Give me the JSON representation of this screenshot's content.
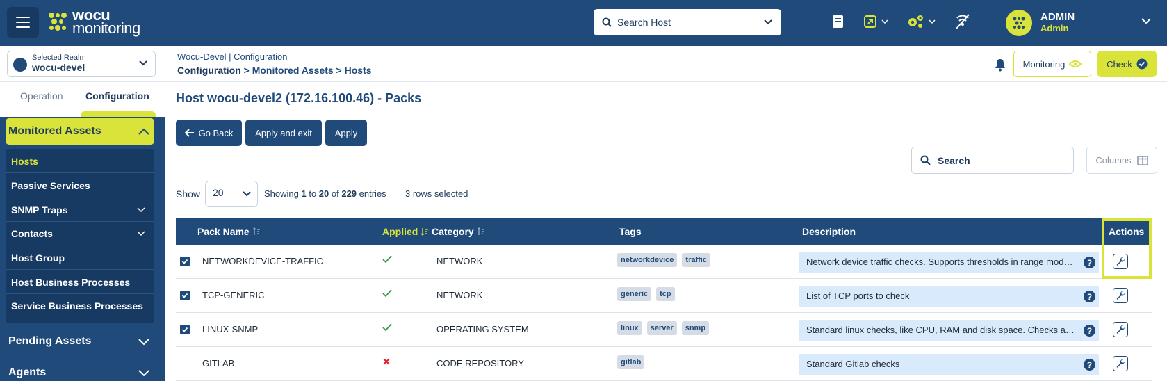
{
  "brand": {
    "line1": "wocu",
    "line2": "monitoring"
  },
  "header": {
    "search_host": "Search Host",
    "user": {
      "name": "ADMIN",
      "role": "Admin"
    }
  },
  "sidebar": {
    "realm": {
      "label": "Selected Realm",
      "value": "wocu-devel"
    },
    "tabs": {
      "operation": "Operation",
      "configuration": "Configuration"
    },
    "monitored_assets": "Monitored Assets",
    "items": [
      {
        "label": "Hosts"
      },
      {
        "label": "Passive Services"
      },
      {
        "label": "SNMP Traps"
      },
      {
        "label": "Contacts"
      },
      {
        "label": "Host Group"
      },
      {
        "label": "Host Business Processes"
      },
      {
        "label": "Service Business Processes"
      }
    ],
    "pending_assets": "Pending Assets",
    "agents": "Agents"
  },
  "breadcrumb": {
    "top": "Wocu-Devel | Configuration",
    "path_first": "Configuration",
    "path_rest": " > Monitored Assets > Hosts"
  },
  "topright": {
    "monitoring": "Monitoring",
    "check": "Check"
  },
  "page": {
    "title": "Host wocu-devel2 (172.16.100.46) - Packs",
    "go_back": "Go Back",
    "apply_exit": "Apply and exit",
    "apply": "Apply",
    "search": "Search",
    "columns": "Columns",
    "show_label": "Show",
    "show_value": "20",
    "showing": {
      "prefix": "Showing ",
      "from": "1",
      "to_word": " to ",
      "to": "20",
      "of_word": " of ",
      "total": "229",
      "suffix": " entries"
    },
    "rows_selected": "3 rows selected"
  },
  "table": {
    "headers": {
      "pack_name": "Pack Name",
      "applied": "Applied",
      "category": "Category",
      "tags": "Tags",
      "description": "Description",
      "actions": "Actions"
    },
    "rows": [
      {
        "checked": true,
        "name": "NETWORKDEVICE-TRAFFIC",
        "applied": true,
        "category": "NETWORK",
        "tags": [
          "networkdevice",
          "traffic"
        ],
        "description": "Network device traffic checks. Supports thresholds in range mode and percent"
      },
      {
        "checked": true,
        "name": "TCP-GENERIC",
        "applied": true,
        "category": "NETWORK",
        "tags": [
          "generic",
          "tcp"
        ],
        "description": "List of TCP ports to check"
      },
      {
        "checked": true,
        "name": "LINUX-SNMP",
        "applied": true,
        "category": "OPERATING SYSTEM",
        "tags": [
          "linux",
          "server",
          "snmp"
        ],
        "description": "Standard linux checks, like CPU, RAM and disk space. Checks are done by SNMP"
      },
      {
        "checked": false,
        "name": "GITLAB",
        "applied": false,
        "category": "CODE REPOSITORY",
        "tags": [
          "gitlab"
        ],
        "description": "Standard Gitlab checks"
      }
    ]
  },
  "colors": {
    "navy": "#1f4a7a",
    "accent": "#d9e33a",
    "applied_yes": "#2e9e3c",
    "applied_no": "#e0202a"
  }
}
